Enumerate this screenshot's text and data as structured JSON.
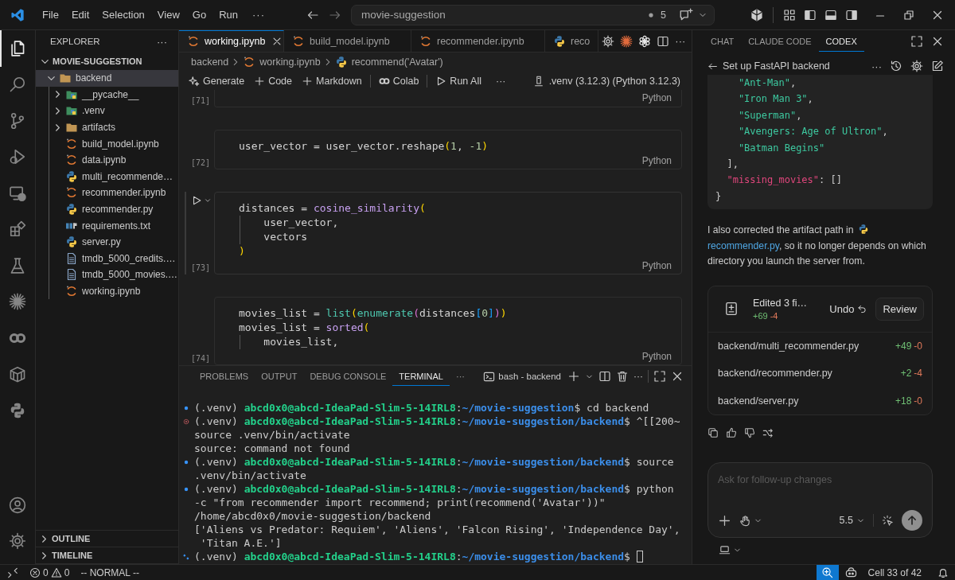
{
  "title_bar": {
    "menu": [
      {
        "label": "File",
        "kind": "menu"
      },
      {
        "label": "Edit",
        "kind": "menu"
      },
      {
        "label": "Selection",
        "kind": "menu"
      },
      {
        "label": "View",
        "kind": "menu"
      },
      {
        "label": "Go",
        "kind": "menu"
      },
      {
        "label": "Run",
        "kind": "menu"
      },
      {
        "label": "···",
        "kind": "more"
      }
    ],
    "search": "movie-suggestion",
    "badge": "5"
  },
  "activity_bar": {
    "top": [
      {
        "kind": "files",
        "selected": true
      },
      {
        "kind": "search",
        "selected": false
      },
      {
        "kind": "branch",
        "selected": false
      },
      {
        "kind": "debug",
        "selected": false
      },
      {
        "kind": "remote",
        "selected": false
      },
      {
        "kind": "extensions",
        "selected": false
      },
      {
        "kind": "flask",
        "selected": false
      },
      {
        "kind": "burst",
        "selected": false
      },
      {
        "kind": "colab",
        "selected": false
      },
      {
        "kind": "box",
        "selected": false
      },
      {
        "kind": "python",
        "selected": false
      }
    ],
    "bottom": [
      {
        "kind": "account",
        "selected": false
      },
      {
        "kind": "gear",
        "selected": false
      }
    ]
  },
  "explorer": {
    "title": "EXPLORER",
    "more": "···",
    "root": {
      "label": "MOVIE-SUGGESTION",
      "expanded": true,
      "selected": false,
      "children": [
        {
          "label": "backend",
          "kind": "folder",
          "expanded": true,
          "selected": true,
          "children": [
            {
              "label": "__pycache__",
              "kind": "folder-py",
              "expanded": false,
              "selected": false
            },
            {
              "label": ".venv",
              "kind": "folder-py",
              "expanded": false,
              "selected": false
            },
            {
              "label": "artifacts",
              "kind": "folder",
              "expanded": false,
              "selected": false
            },
            {
              "label": "build_model.ipynb",
              "kind": "notebook",
              "selected": false
            },
            {
              "label": "data.ipynb",
              "kind": "notebook",
              "selected": false
            },
            {
              "label": "multi_recommende…",
              "kind": "python",
              "selected": false
            },
            {
              "label": "recommender.ipynb",
              "kind": "notebook",
              "selected": false
            },
            {
              "label": "recommender.py",
              "kind": "python",
              "selected": false
            },
            {
              "label": "requirements.txt",
              "kind": "pip",
              "selected": false
            },
            {
              "label": "server.py",
              "kind": "python",
              "selected": false
            },
            {
              "label": "tmdb_5000_credits.…",
              "kind": "text",
              "selected": false
            },
            {
              "label": "tmdb_5000_movies.…",
              "kind": "text",
              "selected": false
            },
            {
              "label": "working.ipynb",
              "kind": "notebook",
              "selected": false
            }
          ]
        }
      ]
    },
    "sections": [
      {
        "label": "OUTLINE",
        "expanded": false
      },
      {
        "label": "TIMELINE",
        "expanded": false
      }
    ]
  },
  "editor": {
    "tabs": [
      {
        "label": "working.ipynb",
        "kind": "notebook",
        "selected": true
      },
      {
        "label": "build_model.ipynb",
        "kind": "notebook",
        "selected": false
      },
      {
        "label": "recommender.ipynb",
        "kind": "notebook",
        "selected": false
      },
      {
        "label": "reco",
        "kind": "python",
        "selected": false
      }
    ],
    "more": "···",
    "breadcrumbs": [
      {
        "label": "backend",
        "kind": "none"
      },
      {
        "label": "working.ipynb",
        "kind": "notebook"
      },
      {
        "label": "recommend('Avatar')",
        "kind": "python"
      }
    ],
    "toolbar": [
      {
        "label": "Generate",
        "kind": "sparkle"
      },
      {
        "label": "Code",
        "kind": "plus"
      },
      {
        "label": "Markdown",
        "kind": "plus"
      },
      {
        "label": "Colab",
        "kind": "colab"
      },
      {
        "label": "Run All",
        "kind": "run"
      },
      {
        "label": "···",
        "kind": "more"
      }
    ],
    "kernel": ".venv (3.12.3) (Python 3.12.3)",
    "cells": [
      {
        "number": "[71]",
        "language": "Python",
        "focused": false
      },
      {
        "number": "[72]",
        "language": "Python",
        "focused": false,
        "lines": [
          {
            "guide": false,
            "tokens": [
              {
                "text": "user_vector = user_vector.reshape",
                "kind": "plain"
              },
              {
                "text": "(",
                "kind": "b1"
              },
              {
                "text": "1",
                "kind": "num"
              },
              {
                "text": ", ",
                "kind": "plain"
              },
              {
                "text": "-1",
                "kind": "num"
              },
              {
                "text": ")",
                "kind": "b1"
              }
            ]
          }
        ]
      },
      {
        "number": "[73]",
        "language": "Python",
        "focused": true,
        "lines": [
          {
            "guide": false,
            "tokens": [
              {
                "text": "distances = ",
                "kind": "plain"
              },
              {
                "text": "cosine_similarity",
                "kind": "fn"
              },
              {
                "text": "(",
                "kind": "b1"
              }
            ]
          },
          {
            "guide": true,
            "tokens": [
              {
                "text": "    user_vector,",
                "kind": "plain"
              }
            ]
          },
          {
            "guide": true,
            "tokens": [
              {
                "text": "    vectors",
                "kind": "plain"
              }
            ]
          },
          {
            "guide": false,
            "tokens": [
              {
                "text": ")",
                "kind": "b1"
              }
            ]
          }
        ]
      },
      {
        "number": "[74]",
        "language": "Python",
        "focused": false,
        "lines": [
          {
            "guide": false,
            "tokens": [
              {
                "text": "movies_list = ",
                "kind": "plain"
              },
              {
                "text": "list",
                "kind": "builtin"
              },
              {
                "text": "(",
                "kind": "b1"
              },
              {
                "text": "enumerate",
                "kind": "builtin"
              },
              {
                "text": "(",
                "kind": "b2"
              },
              {
                "text": "distances",
                "kind": "plain"
              },
              {
                "text": "[",
                "kind": "b3"
              },
              {
                "text": "0",
                "kind": "num"
              },
              {
                "text": "]",
                "kind": "b3"
              },
              {
                "text": ")",
                "kind": "b2"
              },
              {
                "text": ")",
                "kind": "b1"
              }
            ]
          },
          {
            "guide": false,
            "tokens": [
              {
                "text": "movies_list = ",
                "kind": "plain"
              },
              {
                "text": "sorted",
                "kind": "fn"
              },
              {
                "text": "(",
                "kind": "b1"
              }
            ]
          },
          {
            "guide": true,
            "tokens": [
              {
                "text": "    movies_list,",
                "kind": "plain"
              }
            ]
          }
        ]
      }
    ]
  },
  "panel": {
    "tabs": [
      {
        "label": "PROBLEMS",
        "selected": false
      },
      {
        "label": "OUTPUT",
        "selected": false
      },
      {
        "label": "DEBUG CONSOLE",
        "selected": false
      },
      {
        "label": "TERMINAL",
        "selected": true
      }
    ],
    "more": "···",
    "session": "bash - backend",
    "actions_more": "···",
    "lines": [
      {
        "kind": "dot",
        "segments": [
          {
            "text": "(.venv) ",
            "kind": "plain"
          },
          {
            "text": "abcd0x0@abcd-IdeaPad-Slim-5-14IRL8",
            "kind": "user"
          },
          {
            "text": ":",
            "kind": "plain"
          },
          {
            "text": "~/movie-suggestion",
            "kind": "path"
          },
          {
            "text": "$ cd backend",
            "kind": "plain"
          }
        ]
      },
      {
        "kind": "error",
        "segments": [
          {
            "text": "(.venv) ",
            "kind": "plain"
          },
          {
            "text": "abcd0x0@abcd-IdeaPad-Slim-5-14IRL8",
            "kind": "user"
          },
          {
            "text": ":",
            "kind": "plain"
          },
          {
            "text": "~/movie-suggestion/backend",
            "kind": "path"
          },
          {
            "text": "$ ^[[200~",
            "kind": "plain"
          }
        ]
      },
      {
        "kind": "none",
        "segments": [
          {
            "text": "source .venv/bin/activate",
            "kind": "plain"
          }
        ]
      },
      {
        "kind": "none",
        "segments": [
          {
            "text": "source: command not found",
            "kind": "plain"
          }
        ]
      },
      {
        "kind": "dot",
        "segments": [
          {
            "text": "(.venv) ",
            "kind": "plain"
          },
          {
            "text": "abcd0x0@abcd-IdeaPad-Slim-5-14IRL8",
            "kind": "user"
          },
          {
            "text": ":",
            "kind": "plain"
          },
          {
            "text": "~/movie-suggestion/backend",
            "kind": "path"
          },
          {
            "text": "$ source",
            "kind": "plain"
          }
        ]
      },
      {
        "kind": "none",
        "segments": [
          {
            "text": ".venv/bin/activate",
            "kind": "plain"
          }
        ]
      },
      {
        "kind": "dot",
        "segments": [
          {
            "text": "(.venv) ",
            "kind": "plain"
          },
          {
            "text": "abcd0x0@abcd-IdeaPad-Slim-5-14IRL8",
            "kind": "user"
          },
          {
            "text": ":",
            "kind": "plain"
          },
          {
            "text": "~/movie-suggestion/backend",
            "kind": "path"
          },
          {
            "text": "$ python",
            "kind": "plain"
          }
        ]
      },
      {
        "kind": "none",
        "segments": [
          {
            "text": "-c \"from recommender import recommend; print(recommend('Avatar'))\"",
            "kind": "plain"
          }
        ]
      },
      {
        "kind": "none",
        "segments": [
          {
            "text": "/home/abcd0x0/movie-suggestion/backend",
            "kind": "plain"
          }
        ]
      },
      {
        "kind": "none",
        "segments": [
          {
            "text": "['Aliens vs Predator: Requiem', 'Aliens', 'Falcon Rising', 'Independence Day',",
            "kind": "plain"
          }
        ]
      },
      {
        "kind": "none",
        "segments": [
          {
            "text": " 'Titan A.E.']",
            "kind": "plain"
          }
        ]
      },
      {
        "kind": "idle",
        "cursor": true,
        "segments": [
          {
            "text": "(.venv) ",
            "kind": "plain"
          },
          {
            "text": "abcd0x0@abcd-IdeaPad-Slim-5-14IRL8",
            "kind": "user"
          },
          {
            "text": ":",
            "kind": "plain"
          },
          {
            "text": "~/movie-suggestion/backend",
            "kind": "path"
          },
          {
            "text": "$ ",
            "kind": "plain"
          }
        ]
      }
    ]
  },
  "assistant": {
    "tabs": [
      {
        "label": "CHAT",
        "selected": false
      },
      {
        "label": "CLAUDE CODE",
        "selected": false
      },
      {
        "label": "CODEX",
        "selected": true
      }
    ],
    "thread_title": "Set up FastAPI backend",
    "more": "···",
    "code": [
      [
        {
          "text": "    \"Ant-Man\"",
          "kind": "string"
        },
        {
          "text": ",",
          "kind": "plain"
        }
      ],
      [
        {
          "text": "    \"Iron Man 3\"",
          "kind": "string"
        },
        {
          "text": ",",
          "kind": "plain"
        }
      ],
      [
        {
          "text": "    \"Superman\"",
          "kind": "string"
        },
        {
          "text": ",",
          "kind": "plain"
        }
      ],
      [
        {
          "text": "    \"Avengers: Age of Ultron\"",
          "kind": "string"
        },
        {
          "text": ",",
          "kind": "plain"
        }
      ],
      [
        {
          "text": "    \"Batman Begins\"",
          "kind": "string"
        }
      ],
      [
        {
          "text": "  ],",
          "kind": "plain"
        }
      ],
      [
        {
          "text": "  \"missing_movies\"",
          "kind": "key"
        },
        {
          "text": ": []",
          "kind": "plain"
        }
      ],
      [
        {
          "text": "}",
          "kind": "plain"
        }
      ]
    ],
    "message": {
      "before": "I also corrected the artifact path in ",
      "link": "recommender.py",
      "after": ", so it no longer depends on which directory you launch the server from."
    },
    "edits": {
      "title": "Edited 3 fi…",
      "added": "+69",
      "removed": "-4",
      "undo": "Undo",
      "review": "Review",
      "files": [
        {
          "path": "backend/multi_recommender.py",
          "added": "+49",
          "removed": "-0"
        },
        {
          "path": "backend/recommender.py",
          "added": "+2",
          "removed": "-4"
        },
        {
          "path": "backend/server.py",
          "added": "+18",
          "removed": "-0"
        }
      ]
    },
    "composer": {
      "placeholder": "Ask for follow-up changes",
      "model": "5.5"
    }
  },
  "status_bar": {
    "errors": "0",
    "warnings": "0",
    "mode": "-- NORMAL --",
    "cell": "Cell 33 of 42"
  }
}
